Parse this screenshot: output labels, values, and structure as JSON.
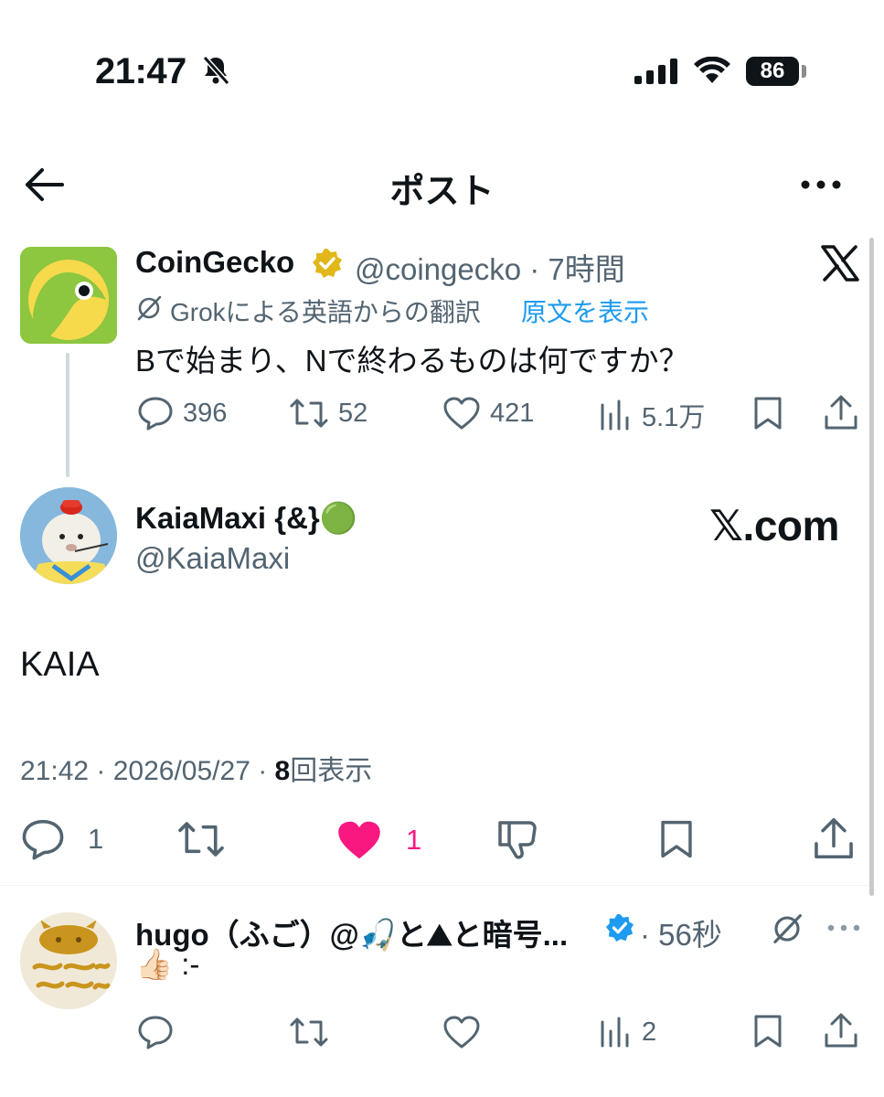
{
  "status_bar": {
    "time": "21:47",
    "battery": "86"
  },
  "header": {
    "title": "ポスト"
  },
  "quoted_post": {
    "name": "CoinGecko",
    "handle_time": "@coingecko · 7時間",
    "translation_note": "Grokによる英語からの翻訳",
    "translation_link": "原文を表示",
    "text": "Bで始まり、Nで終わるものは何ですか？",
    "replies": "396",
    "reposts": "52",
    "likes": "421",
    "views": "5.1万"
  },
  "main_post": {
    "name": "KaiaMaxi {&}🟢",
    "handle": "@KaiaMaxi",
    "source_badge": "𝕏.com",
    "text": "KAIA",
    "time": "21:42 · 2026/05/27 · ",
    "view_count": "8",
    "view_label": "回表示",
    "replies": "1",
    "likes": "1"
  },
  "reply": {
    "name": "hugo（ふご）@🎣と⛰と暗号...",
    "time": "· 56秒",
    "text": "👍🏻 :-",
    "views": "2"
  },
  "colors": {
    "accent": "#1d9bf0",
    "like": "#f91880",
    "gold": "#e2b719",
    "muted": "#536471"
  }
}
